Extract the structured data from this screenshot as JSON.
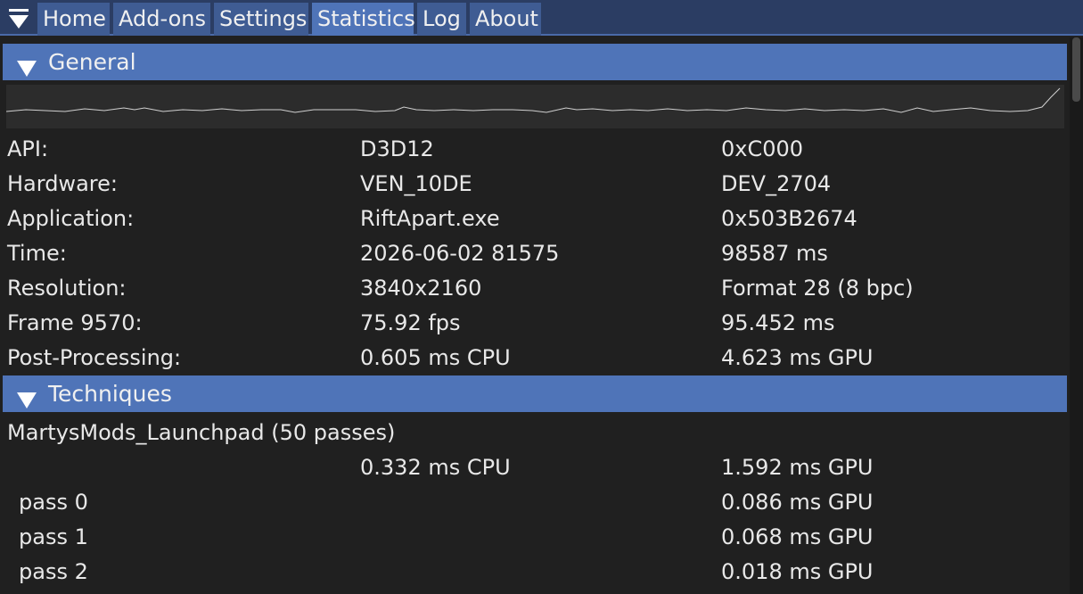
{
  "tabs": [
    {
      "label": "Home"
    },
    {
      "label": "Add-ons"
    },
    {
      "label": "Settings"
    },
    {
      "label": "Statistics"
    },
    {
      "label": "Log"
    },
    {
      "label": "About"
    }
  ],
  "active_tab": "Statistics",
  "icons": {
    "menu": "triangle-down-menu-icon",
    "collapse": "triangle-down-icon"
  },
  "colors": {
    "accent": "#4f74b8",
    "tab": "#3f5c93",
    "tabbar": "#2b3d63",
    "background": "#202020",
    "graph_bg": "#2c2c2c",
    "text": "#e8e8e8"
  },
  "general": {
    "title": "General",
    "rows": [
      {
        "label": "API:",
        "value": "D3D12",
        "extra": "0xC000"
      },
      {
        "label": "Hardware:",
        "value": "VEN_10DE",
        "extra": "DEV_2704"
      },
      {
        "label": "Application:",
        "value": "RiftApart.exe",
        "extra": "0x503B2674"
      },
      {
        "label": "Time:",
        "value": "2026-06-02 81575",
        "extra": "98587 ms"
      },
      {
        "label": "Resolution:",
        "value": "3840x2160",
        "extra": "Format 28 (8 bpc)"
      },
      {
        "label": "Frame 9570:",
        "value": "75.92 fps",
        "extra": "95.452 ms"
      },
      {
        "label": "Post-Processing:",
        "value": "0.605 ms CPU",
        "extra": "4.623 ms GPU"
      }
    ]
  },
  "techniques": {
    "title": "Techniques",
    "technique_name": "MartysMods_Launchpad (50 passes)",
    "cpu": "0.332 ms CPU",
    "gpu": "1.592 ms GPU",
    "passes": [
      {
        "label": "pass 0",
        "gpu": "0.086 ms GPU"
      },
      {
        "label": "pass 1",
        "gpu": "0.068 ms GPU"
      },
      {
        "label": "pass 2",
        "gpu": "0.018 ms GPU"
      }
    ]
  }
}
